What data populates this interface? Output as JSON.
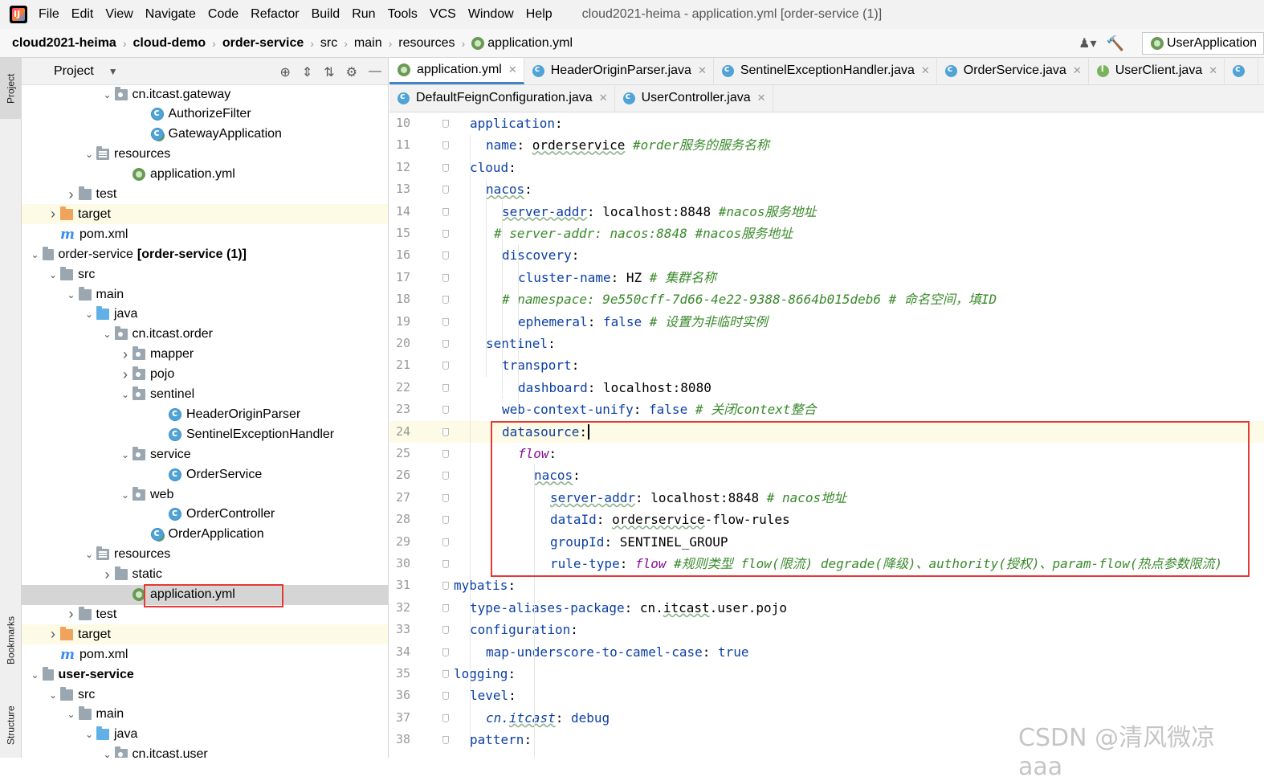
{
  "menubar": {
    "items": [
      "File",
      "Edit",
      "View",
      "Navigate",
      "Code",
      "Refactor",
      "Build",
      "Run",
      "Tools",
      "VCS",
      "Window",
      "Help"
    ],
    "title": "cloud2021-heima - application.yml [order-service (1)]"
  },
  "navbar": {
    "crumbs": [
      "cloud2021-heima",
      "cloud-demo",
      "order-service",
      "src",
      "main",
      "resources",
      "application.yml"
    ],
    "run_config": "UserApplication"
  },
  "left_strip": {
    "project": "Project",
    "bookmarks": "Bookmarks",
    "structure": "Structure"
  },
  "project": {
    "title": "Project",
    "tree": [
      {
        "indent": 7,
        "arrow": "v",
        "icon": "pkg",
        "label": "cn.itcast.gateway"
      },
      {
        "indent": 9,
        "arrow": "",
        "icon": "cls",
        "label": "AuthorizeFilter"
      },
      {
        "indent": 9,
        "arrow": "",
        "icon": "app",
        "label": "GatewayApplication"
      },
      {
        "indent": 6,
        "arrow": "v",
        "icon": "res",
        "label": "resources"
      },
      {
        "indent": 8,
        "arrow": "",
        "icon": "yml",
        "label": "application.yml"
      },
      {
        "indent": 5,
        "arrow": ">",
        "icon": "folder",
        "label": "test"
      },
      {
        "indent": 4,
        "arrow": ">",
        "icon": "orange",
        "label": "target"
      },
      {
        "indent": 4,
        "arrow": "",
        "icon": "m",
        "label": "pom.xml"
      },
      {
        "indent": 3,
        "arrow": "v",
        "icon": "mod",
        "label": "order-service",
        "bold": "[order-service (1)]"
      },
      {
        "indent": 4,
        "arrow": "v",
        "icon": "folder",
        "label": "src"
      },
      {
        "indent": 5,
        "arrow": "v",
        "icon": "folder",
        "label": "main"
      },
      {
        "indent": 6,
        "arrow": "v",
        "icon": "blue",
        "label": "java"
      },
      {
        "indent": 7,
        "arrow": "v",
        "icon": "pkg",
        "label": "cn.itcast.order"
      },
      {
        "indent": 8,
        "arrow": ">",
        "icon": "pkg",
        "label": "mapper"
      },
      {
        "indent": 8,
        "arrow": ">",
        "icon": "pkg",
        "label": "pojo"
      },
      {
        "indent": 8,
        "arrow": "v",
        "icon": "pkg",
        "label": "sentinel"
      },
      {
        "indent": 10,
        "arrow": "",
        "icon": "cls",
        "label": "HeaderOriginParser"
      },
      {
        "indent": 10,
        "arrow": "",
        "icon": "cls",
        "label": "SentinelExceptionHandler"
      },
      {
        "indent": 8,
        "arrow": "v",
        "icon": "pkg",
        "label": "service"
      },
      {
        "indent": 10,
        "arrow": "",
        "icon": "cls",
        "label": "OrderService"
      },
      {
        "indent": 8,
        "arrow": "v",
        "icon": "pkg",
        "label": "web"
      },
      {
        "indent": 10,
        "arrow": "",
        "icon": "cls",
        "label": "OrderController"
      },
      {
        "indent": 9,
        "arrow": "",
        "icon": "app",
        "label": "OrderApplication"
      },
      {
        "indent": 6,
        "arrow": "v",
        "icon": "res",
        "label": "resources"
      },
      {
        "indent": 7,
        "arrow": ">",
        "icon": "folder",
        "label": "static"
      },
      {
        "indent": 8,
        "arrow": "",
        "icon": "yml",
        "label": "application.yml"
      },
      {
        "indent": 5,
        "arrow": ">",
        "icon": "folder",
        "label": "test"
      },
      {
        "indent": 4,
        "arrow": ">",
        "icon": "orange",
        "label": "target"
      },
      {
        "indent": 4,
        "arrow": "",
        "icon": "m",
        "label": "pom.xml"
      },
      {
        "indent": 3,
        "arrow": "v",
        "icon": "mod",
        "label": "",
        "bold": "user-service"
      },
      {
        "indent": 4,
        "arrow": "v",
        "icon": "folder",
        "label": "src"
      },
      {
        "indent": 5,
        "arrow": "v",
        "icon": "folder",
        "label": "main"
      },
      {
        "indent": 6,
        "arrow": "v",
        "icon": "blue",
        "label": "java"
      },
      {
        "indent": 7,
        "arrow": "v",
        "icon": "pkg",
        "label": "cn.itcast.user"
      }
    ]
  },
  "editor": {
    "tabs_row1": [
      {
        "label": "application.yml",
        "icon": "yml",
        "active": true
      },
      {
        "label": "HeaderOriginParser.java",
        "icon": "cls"
      },
      {
        "label": "SentinelExceptionHandler.java",
        "icon": "cls"
      },
      {
        "label": "OrderService.java",
        "icon": "cls"
      },
      {
        "label": "UserClient.java",
        "icon": "iface"
      }
    ],
    "tabs_row2": [
      {
        "label": "DefaultFeignConfiguration.java",
        "icon": "cls"
      },
      {
        "label": "UserController.java",
        "icon": "cls"
      }
    ],
    "lines": [
      {
        "n": "10",
        "ind": 1,
        "parts": [
          [
            "k",
            "application"
          ],
          [
            "v",
            ":"
          ]
        ]
      },
      {
        "n": "11",
        "ind": 2,
        "parts": [
          [
            "k",
            "name"
          ],
          [
            "v",
            ": "
          ],
          [
            "vu",
            "orderservice"
          ],
          [
            "v",
            " "
          ],
          [
            "c",
            "#order服务的服务名称"
          ]
        ]
      },
      {
        "n": "12",
        "ind": 1,
        "parts": [
          [
            "k",
            "cloud"
          ],
          [
            "v",
            ":"
          ]
        ]
      },
      {
        "n": "13",
        "ind": 2,
        "parts": [
          [
            "ku",
            "nacos"
          ],
          [
            "v",
            ":"
          ]
        ]
      },
      {
        "n": "14",
        "ind": 3,
        "parts": [
          [
            "ku",
            "server-addr"
          ],
          [
            "v",
            ": localhost:8848 "
          ],
          [
            "c",
            "#nacos服务地址"
          ]
        ]
      },
      {
        "n": "15",
        "ind": 2.5,
        "parts": [
          [
            "c",
            "# server-addr: nacos:8848 #nacos服务地址"
          ]
        ]
      },
      {
        "n": "16",
        "ind": 3,
        "parts": [
          [
            "k",
            "discovery"
          ],
          [
            "v",
            ":"
          ]
        ]
      },
      {
        "n": "17",
        "ind": 4,
        "parts": [
          [
            "k",
            "cluster-name"
          ],
          [
            "v",
            ": HZ "
          ],
          [
            "c",
            "# 集群名称"
          ]
        ]
      },
      {
        "n": "18",
        "ind": 3,
        "parts": [
          [
            "c",
            "# namespace: 9e550cff-7d66-4e22-9388-8664b015deb6 # 命名空间，填ID"
          ]
        ]
      },
      {
        "n": "19",
        "ind": 4,
        "parts": [
          [
            "k",
            "ephemeral"
          ],
          [
            "v",
            ": "
          ],
          [
            "b",
            "false"
          ],
          [
            "v",
            " "
          ],
          [
            "c",
            "# 设置为非临时实例"
          ]
        ]
      },
      {
        "n": "20",
        "ind": 2,
        "parts": [
          [
            "k",
            "sentinel"
          ],
          [
            "v",
            ":"
          ]
        ]
      },
      {
        "n": "21",
        "ind": 3,
        "parts": [
          [
            "k",
            "transport"
          ],
          [
            "v",
            ":"
          ]
        ]
      },
      {
        "n": "22",
        "ind": 4,
        "parts": [
          [
            "k",
            "dashboard"
          ],
          [
            "v",
            ": localhost:8080"
          ]
        ]
      },
      {
        "n": "23",
        "ind": 3,
        "parts": [
          [
            "k",
            "web-context-unify"
          ],
          [
            "v",
            ": "
          ],
          [
            "b",
            "false"
          ],
          [
            "v",
            " "
          ],
          [
            "c",
            "# 关闭context整合"
          ]
        ]
      },
      {
        "n": "24",
        "ind": 3,
        "parts": [
          [
            "k",
            "datasource"
          ],
          [
            "v",
            ":"
          ]
        ]
      },
      {
        "n": "25",
        "ind": 4,
        "parts": [
          [
            "p",
            "flow"
          ],
          [
            "v",
            ":"
          ]
        ]
      },
      {
        "n": "26",
        "ind": 5,
        "parts": [
          [
            "ku",
            "nacos"
          ],
          [
            "v",
            ":"
          ]
        ]
      },
      {
        "n": "27",
        "ind": 6,
        "parts": [
          [
            "ku",
            "server-addr"
          ],
          [
            "v",
            ": localhost:8848 "
          ],
          [
            "c",
            "# nacos地址"
          ]
        ]
      },
      {
        "n": "28",
        "ind": 6,
        "parts": [
          [
            "k",
            "dataId"
          ],
          [
            "v",
            ": "
          ],
          [
            "vu",
            "orderservice"
          ],
          [
            "v",
            "-flow-rules"
          ]
        ]
      },
      {
        "n": "29",
        "ind": 6,
        "parts": [
          [
            "k",
            "groupId"
          ],
          [
            "v",
            ": SENTINEL_GROUP"
          ]
        ]
      },
      {
        "n": "30",
        "ind": 6,
        "parts": [
          [
            "k",
            "rule-type"
          ],
          [
            "v",
            ": "
          ],
          [
            "p",
            "flow"
          ],
          [
            "v",
            " "
          ],
          [
            "c",
            "#规则类型 flow(限流) degrade(降级)、authority(授权)、param-flow(热点参数限流)"
          ]
        ]
      },
      {
        "n": "31",
        "ind": 0,
        "parts": [
          [
            "k",
            "mybatis"
          ],
          [
            "v",
            ":"
          ]
        ]
      },
      {
        "n": "32",
        "ind": 1,
        "parts": [
          [
            "k",
            "type-aliases-package"
          ],
          [
            "v",
            ": cn."
          ],
          [
            "vu",
            "itcast"
          ],
          [
            "v",
            ".user.pojo"
          ]
        ]
      },
      {
        "n": "33",
        "ind": 1,
        "parts": [
          [
            "k",
            "configuration"
          ],
          [
            "v",
            ":"
          ]
        ]
      },
      {
        "n": "34",
        "ind": 2,
        "parts": [
          [
            "k",
            "map-underscore-to-camel-case"
          ],
          [
            "v",
            ": "
          ],
          [
            "b",
            "true"
          ]
        ]
      },
      {
        "n": "35",
        "ind": 0,
        "parts": [
          [
            "k",
            "logging"
          ],
          [
            "v",
            ":"
          ]
        ]
      },
      {
        "n": "36",
        "ind": 1,
        "parts": [
          [
            "k",
            "level"
          ],
          [
            "v",
            ":"
          ]
        ]
      },
      {
        "n": "37",
        "ind": 2,
        "parts": [
          [
            "pk",
            "cn."
          ],
          [
            "pku",
            "itcast"
          ],
          [
            "v",
            ": "
          ],
          [
            "b",
            "debug"
          ]
        ]
      },
      {
        "n": "38",
        "ind": 1,
        "parts": [
          [
            "k",
            "pattern"
          ],
          [
            "v",
            ":"
          ]
        ]
      }
    ]
  },
  "watermark": "CSDN @清风微凉 aaa",
  "colors": {
    "key": "#0b3fa4",
    "comment": "#3a8a2b",
    "italic_key": "#871094",
    "highlight_box": "#e53935",
    "caret_line": "#fdfbe5"
  }
}
